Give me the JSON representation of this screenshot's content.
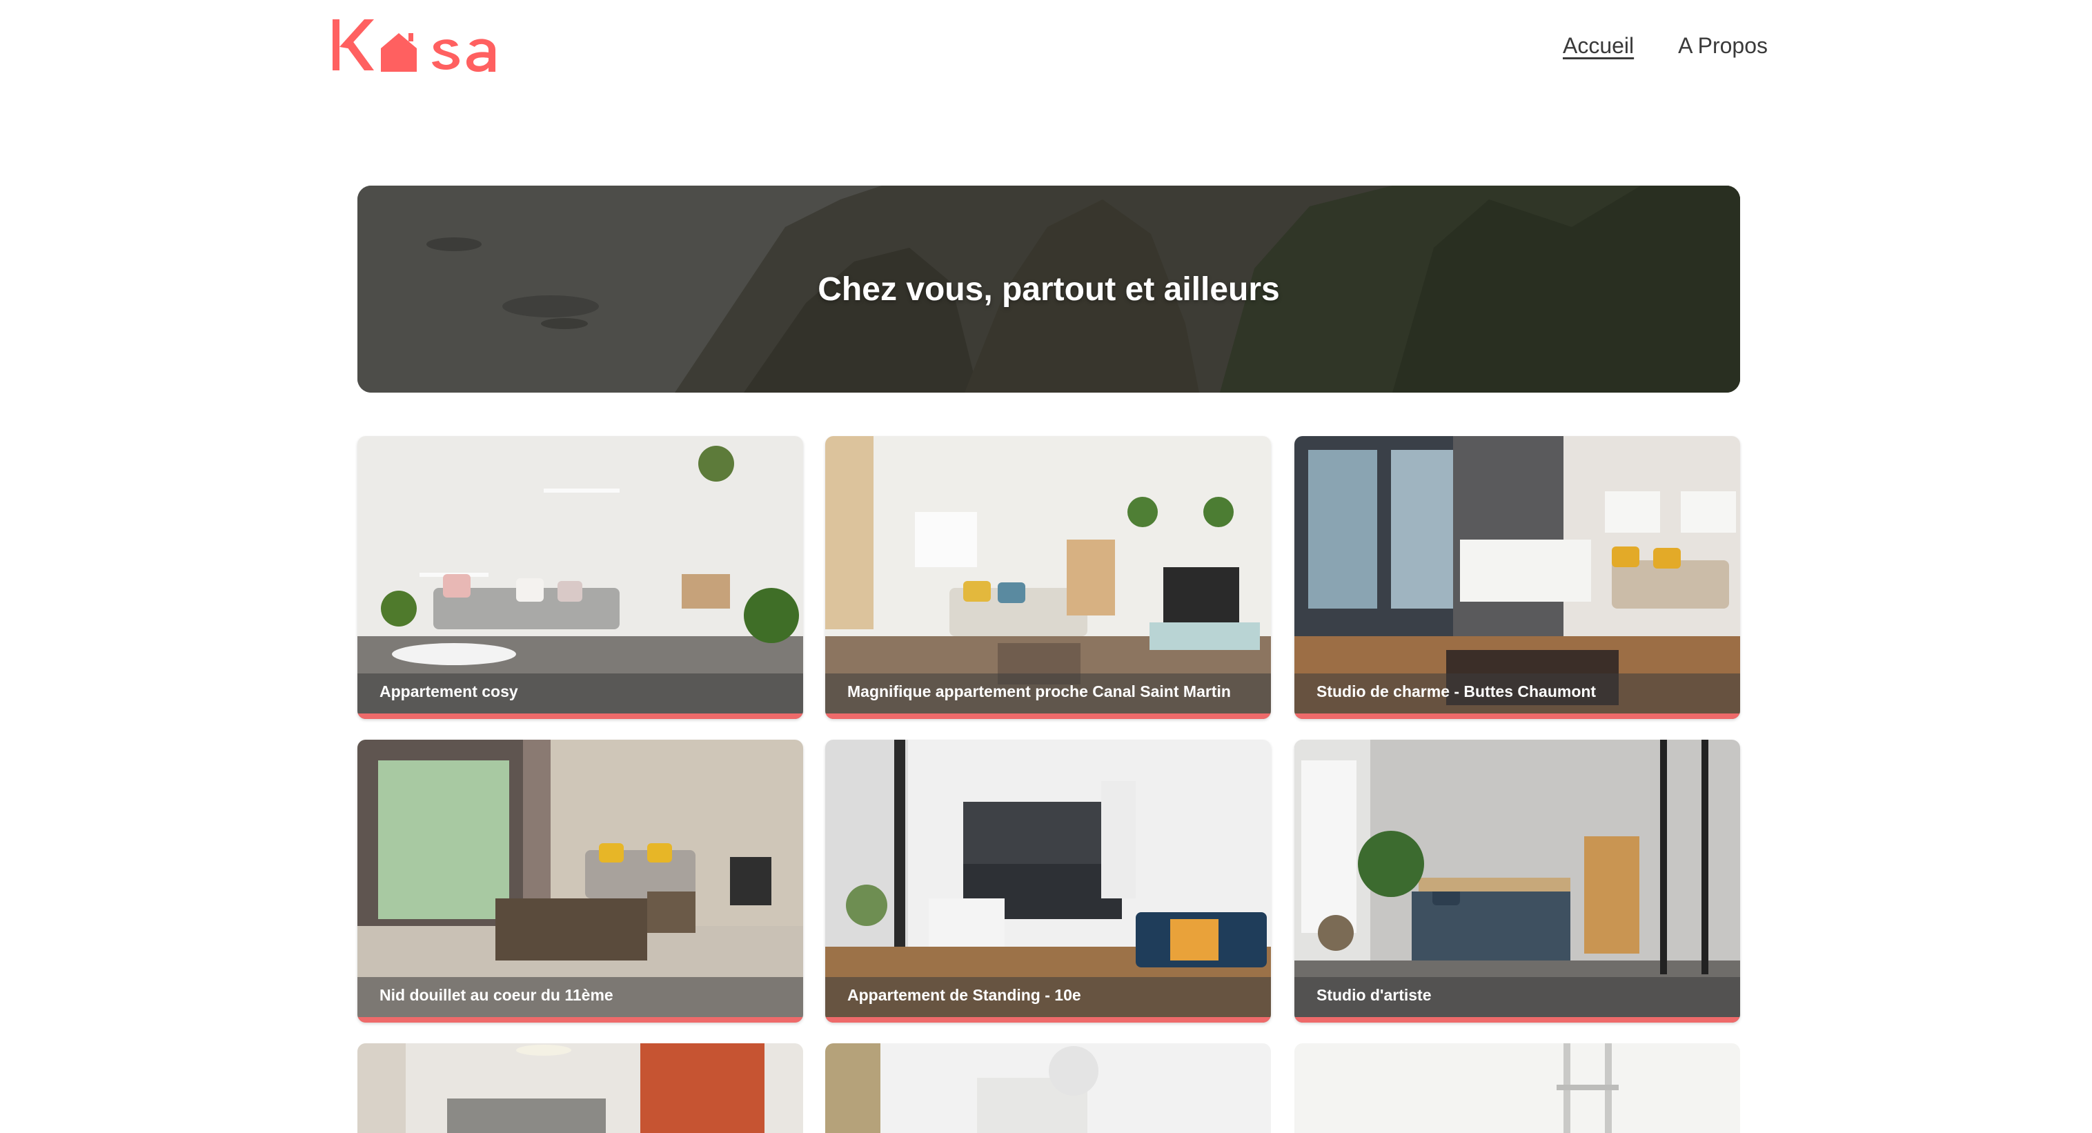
{
  "header": {
    "logo_text": "Kasa",
    "nav": [
      {
        "label": "Accueil",
        "active": true
      },
      {
        "label": "A Propos",
        "active": false
      }
    ]
  },
  "banner": {
    "title": "Chez vous, partout et ailleurs"
  },
  "listings": [
    {
      "title": "Appartement cosy"
    },
    {
      "title": "Magnifique appartement proche Canal Saint Martin"
    },
    {
      "title": "Studio de charme - Buttes Chaumont"
    },
    {
      "title": "Nid douillet au coeur du 11ème"
    },
    {
      "title": "Appartement de Standing - 10e"
    },
    {
      "title": "Studio d'artiste"
    }
  ],
  "colors": {
    "brand": "#ff6060",
    "accent_bar": "#ee6a6a"
  }
}
